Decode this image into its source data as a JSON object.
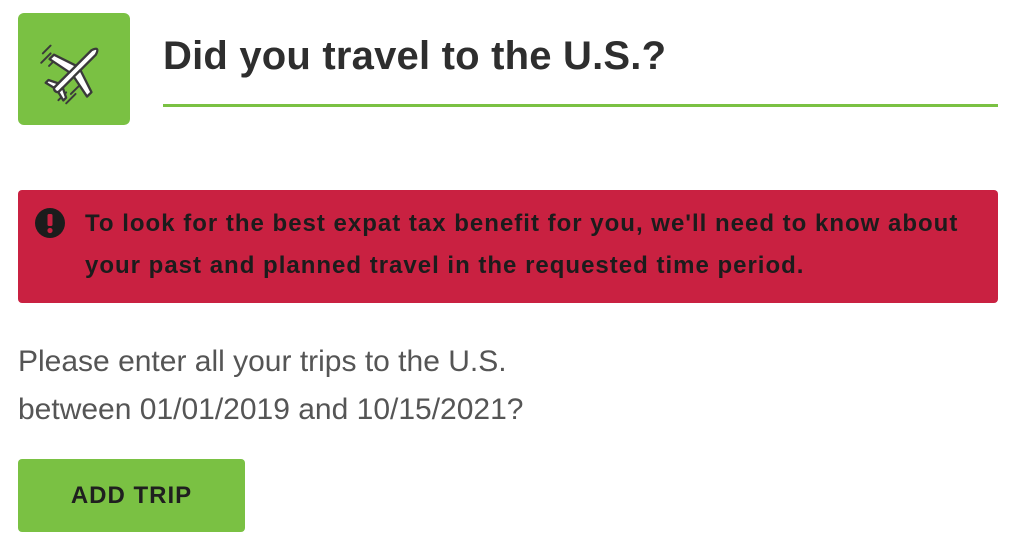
{
  "header": {
    "icon": "airplane-icon",
    "title": "Did you travel to the U.S.?"
  },
  "alert": {
    "icon": "exclamation-circle-icon",
    "message": "To look for the best expat tax benefit for you, we'll need to know about your past and planned travel in the requested time period."
  },
  "instructions": {
    "line1": "Please enter all your trips to the U.S.",
    "line2": "between 01/01/2019 and 10/15/2021?"
  },
  "actions": {
    "add_trip_label": "ADD TRIP"
  },
  "colors": {
    "accent_green": "#7ac143",
    "alert_red": "#c92141",
    "title_text": "#2e2e2e",
    "body_text": "#555555"
  }
}
